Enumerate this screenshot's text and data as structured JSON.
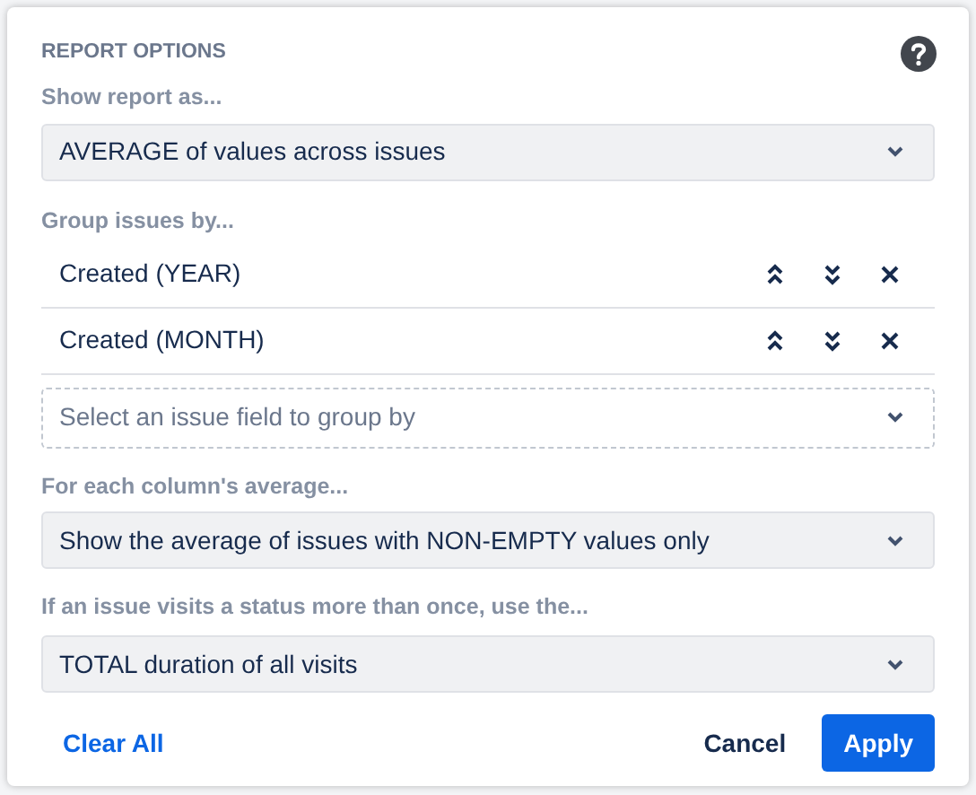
{
  "dialog": {
    "title": "REPORT OPTIONS",
    "show_report_as": {
      "label": "Show report as...",
      "value": "AVERAGE of values across issues"
    },
    "group_by": {
      "label": "Group issues by...",
      "items": [
        {
          "label": "Created (YEAR)"
        },
        {
          "label": "Created (MONTH)"
        }
      ],
      "add_field": {
        "placeholder": "Select an issue field to group by"
      }
    },
    "column_average": {
      "label": "For each column's average...",
      "value": "Show the average of issues with NON-EMPTY values only"
    },
    "status_visits": {
      "label": "If an issue visits a status more than once, use the...",
      "value": "TOTAL duration of all visits"
    },
    "buttons": {
      "clear": "Clear All",
      "cancel": "Cancel",
      "apply": "Apply"
    }
  }
}
